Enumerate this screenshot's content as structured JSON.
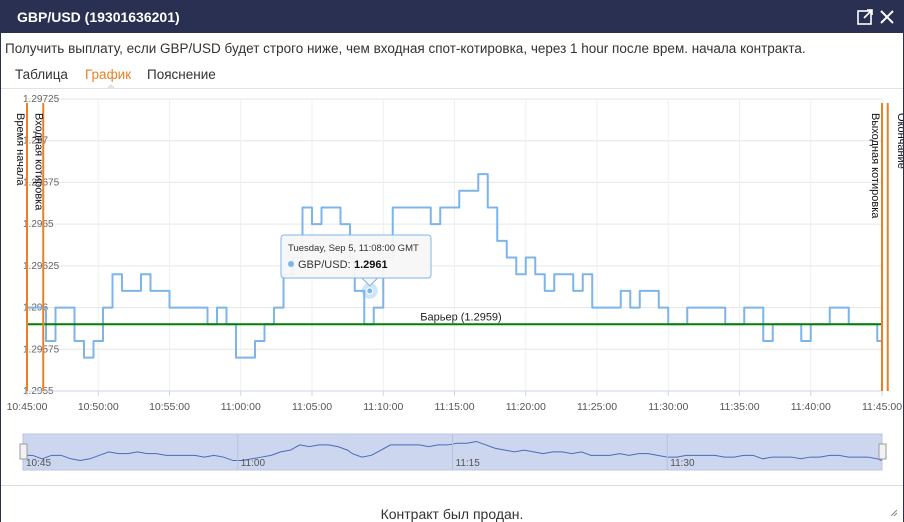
{
  "window": {
    "title": "GBP/USD (19301636201)",
    "icons": {
      "popout": "popout-icon",
      "close": "close-icon"
    }
  },
  "description": "Получить выплату, если GBP/USD будет строго ниже, чем входная спот-котировка, через 1 hour после врем. начала контракта.",
  "tabs": [
    {
      "label": "Таблица",
      "active": false
    },
    {
      "label": "График",
      "active": true
    },
    {
      "label": "Пояснение",
      "active": false
    }
  ],
  "colors": {
    "accent": "#e98024",
    "series": "#7cb5ec",
    "barrier": "#008000",
    "titlebar": "#2a3052",
    "navigator_fill": "#cdd6ef"
  },
  "chart_data": {
    "type": "line",
    "series": [
      {
        "name": "GBP/USD",
        "x": [
          "10:45:00",
          "10:45:40",
          "10:46:20",
          "10:47:00",
          "10:47:40",
          "10:48:20",
          "10:49:00",
          "10:49:40",
          "10:50:20",
          "10:51:00",
          "10:51:40",
          "10:52:20",
          "10:53:00",
          "10:53:40",
          "10:54:20",
          "10:55:00",
          "10:55:40",
          "10:56:20",
          "10:57:00",
          "10:57:40",
          "10:58:20",
          "10:59:00",
          "10:59:40",
          "11:00:20",
          "11:01:00",
          "11:01:40",
          "11:02:20",
          "11:03:00",
          "11:03:40",
          "11:04:20",
          "11:05:00",
          "11:05:40",
          "11:06:20",
          "11:07:00",
          "11:07:40",
          "11:08:00",
          "11:08:40",
          "11:09:20",
          "11:10:00",
          "11:10:40",
          "11:11:20",
          "11:12:00",
          "11:12:40",
          "11:13:20",
          "11:14:00",
          "11:14:40",
          "11:15:20",
          "11:16:00",
          "11:16:40",
          "11:17:20",
          "11:18:00",
          "11:18:40",
          "11:19:20",
          "11:20:00",
          "11:20:40",
          "11:21:20",
          "11:22:00",
          "11:22:40",
          "11:23:20",
          "11:24:00",
          "11:24:40",
          "11:25:20",
          "11:26:00",
          "11:26:40",
          "11:27:20",
          "11:28:00",
          "11:28:40",
          "11:29:20",
          "11:30:00",
          "11:30:40",
          "11:31:20",
          "11:32:00",
          "11:32:40",
          "11:33:20",
          "11:34:00",
          "11:34:40",
          "11:35:20",
          "11:36:00",
          "11:36:40",
          "11:37:20",
          "11:38:00",
          "11:38:40",
          "11:39:20",
          "11:40:00",
          "11:40:40",
          "11:41:20",
          "11:42:00",
          "11:42:40",
          "11:43:20",
          "11:44:00",
          "11:44:40",
          "11:45:00"
        ],
        "values": [
          1.296,
          1.296,
          1.2958,
          1.296,
          1.296,
          1.2958,
          1.2957,
          1.2958,
          1.296,
          1.2962,
          1.2961,
          1.2961,
          1.2962,
          1.2961,
          1.2961,
          1.296,
          1.296,
          1.296,
          1.296,
          1.2959,
          1.296,
          1.2959,
          1.2957,
          1.2957,
          1.2958,
          1.2959,
          1.296,
          1.2962,
          1.2963,
          1.2966,
          1.2965,
          1.2966,
          1.2966,
          1.2965,
          1.2963,
          1.2961,
          1.2959,
          1.296,
          1.2963,
          1.2966,
          1.2966,
          1.2966,
          1.2966,
          1.2965,
          1.2966,
          1.2966,
          1.2967,
          1.2967,
          1.2968,
          1.2966,
          1.2964,
          1.2963,
          1.2962,
          1.2963,
          1.2962,
          1.2961,
          1.2962,
          1.2962,
          1.2961,
          1.2962,
          1.296,
          1.296,
          1.296,
          1.2961,
          1.296,
          1.2961,
          1.2961,
          1.296,
          1.2959,
          1.2959,
          1.296,
          1.296,
          1.296,
          1.296,
          1.2959,
          1.2959,
          1.296,
          1.296,
          1.2958,
          1.2959,
          1.2959,
          1.2959,
          1.2958,
          1.2959,
          1.2959,
          1.296,
          1.296,
          1.2959,
          1.2959,
          1.2959,
          1.2958,
          1.2957
        ]
      }
    ],
    "xlim": [
      "10:45:00",
      "11:45:00"
    ],
    "ylim": [
      1.2955,
      1.29725
    ],
    "x_ticks": [
      "10:45:00",
      "10:50:00",
      "10:55:00",
      "11:00:00",
      "11:05:00",
      "11:10:00",
      "11:15:00",
      "11:20:00",
      "11:25:00",
      "11:30:00",
      "11:35:00",
      "11:40:00",
      "11:45:00"
    ],
    "y_ticks": [
      "1.2955",
      "1.29575",
      "1.296",
      "1.29625",
      "1.2965",
      "1.29675",
      "1.297",
      "1.29725"
    ],
    "grid": true,
    "barrier": {
      "value": 1.2959,
      "label": "Барьер (1.2959)"
    },
    "vertical_lines": [
      {
        "time": "10:45:00",
        "label": "Время начала"
      },
      {
        "time": "10:46:00",
        "label": "Входная котировка"
      },
      {
        "time": "11:45:00",
        "label": "Выходная котировка"
      },
      {
        "time": "11:45:20",
        "label": "Окончание"
      }
    ],
    "tooltip": {
      "header": "Tuesday, Sep 5, 11:08:00 GMT",
      "series_label": "GBP/USD:",
      "value": "1.2961",
      "time": "11:08:00"
    },
    "navigator": {
      "labels": [
        "10:45",
        "11:00",
        "11:15",
        "11:30"
      ]
    }
  },
  "footer": {
    "status": "Контракт был продан."
  }
}
